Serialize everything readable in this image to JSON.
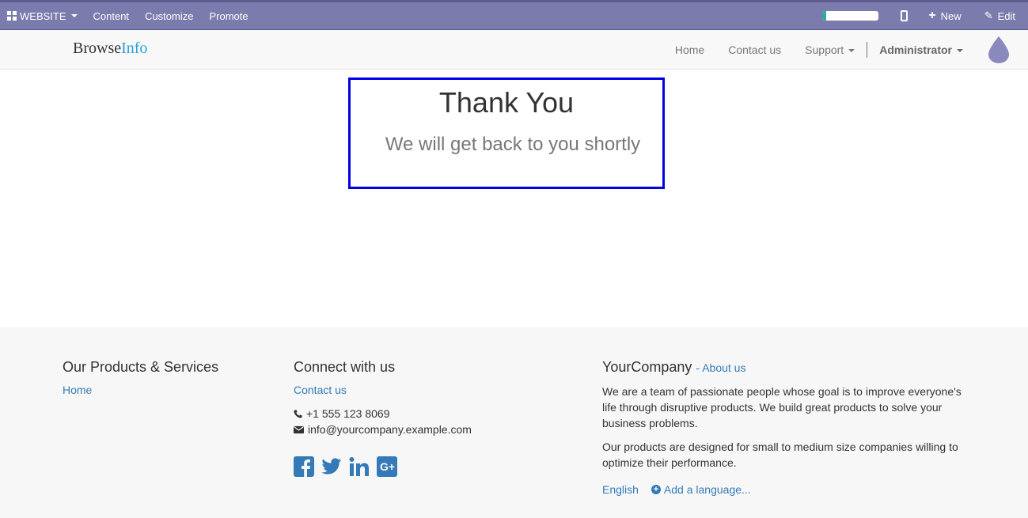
{
  "adminbar": {
    "website_label": "WEBSITE",
    "menu": [
      "Content",
      "Customize",
      "Promote"
    ],
    "progress_percent": 0.05,
    "new_label": "New",
    "edit_label": "Edit"
  },
  "navbar": {
    "brand_part1": "Browse",
    "brand_part2": "Info",
    "home": "Home",
    "contact": "Contact us",
    "support": "Support",
    "admin": "Administrator"
  },
  "thanks": {
    "title": "Thank You",
    "subtitle": "We will get back to you shortly"
  },
  "footer": {
    "col1": {
      "heading": "Our Products & Services",
      "link": "Home"
    },
    "col2": {
      "heading": "Connect with us",
      "link": "Contact us",
      "phone": "+1 555 123 8069",
      "email": "info@yourcompany.example.com",
      "social": [
        "facebook-icon",
        "twitter-icon",
        "linkedin-icon",
        "google-plus-icon"
      ]
    },
    "col3": {
      "heading": "YourCompany",
      "about_link": "- About us",
      "p1": "We are a team of passionate people whose goal is to improve everyone's life through disruptive products. We build great products to solve your business problems.",
      "p2": "Our products are designed for small to medium size companies willing to optimize their performance.",
      "language": "English",
      "add_language": "Add a language..."
    }
  },
  "colors": {
    "adminbar": "#7c7bad",
    "brand_accent": "#2b9fd8",
    "link": "#337ab7",
    "highlight_border": "#0000e6"
  }
}
